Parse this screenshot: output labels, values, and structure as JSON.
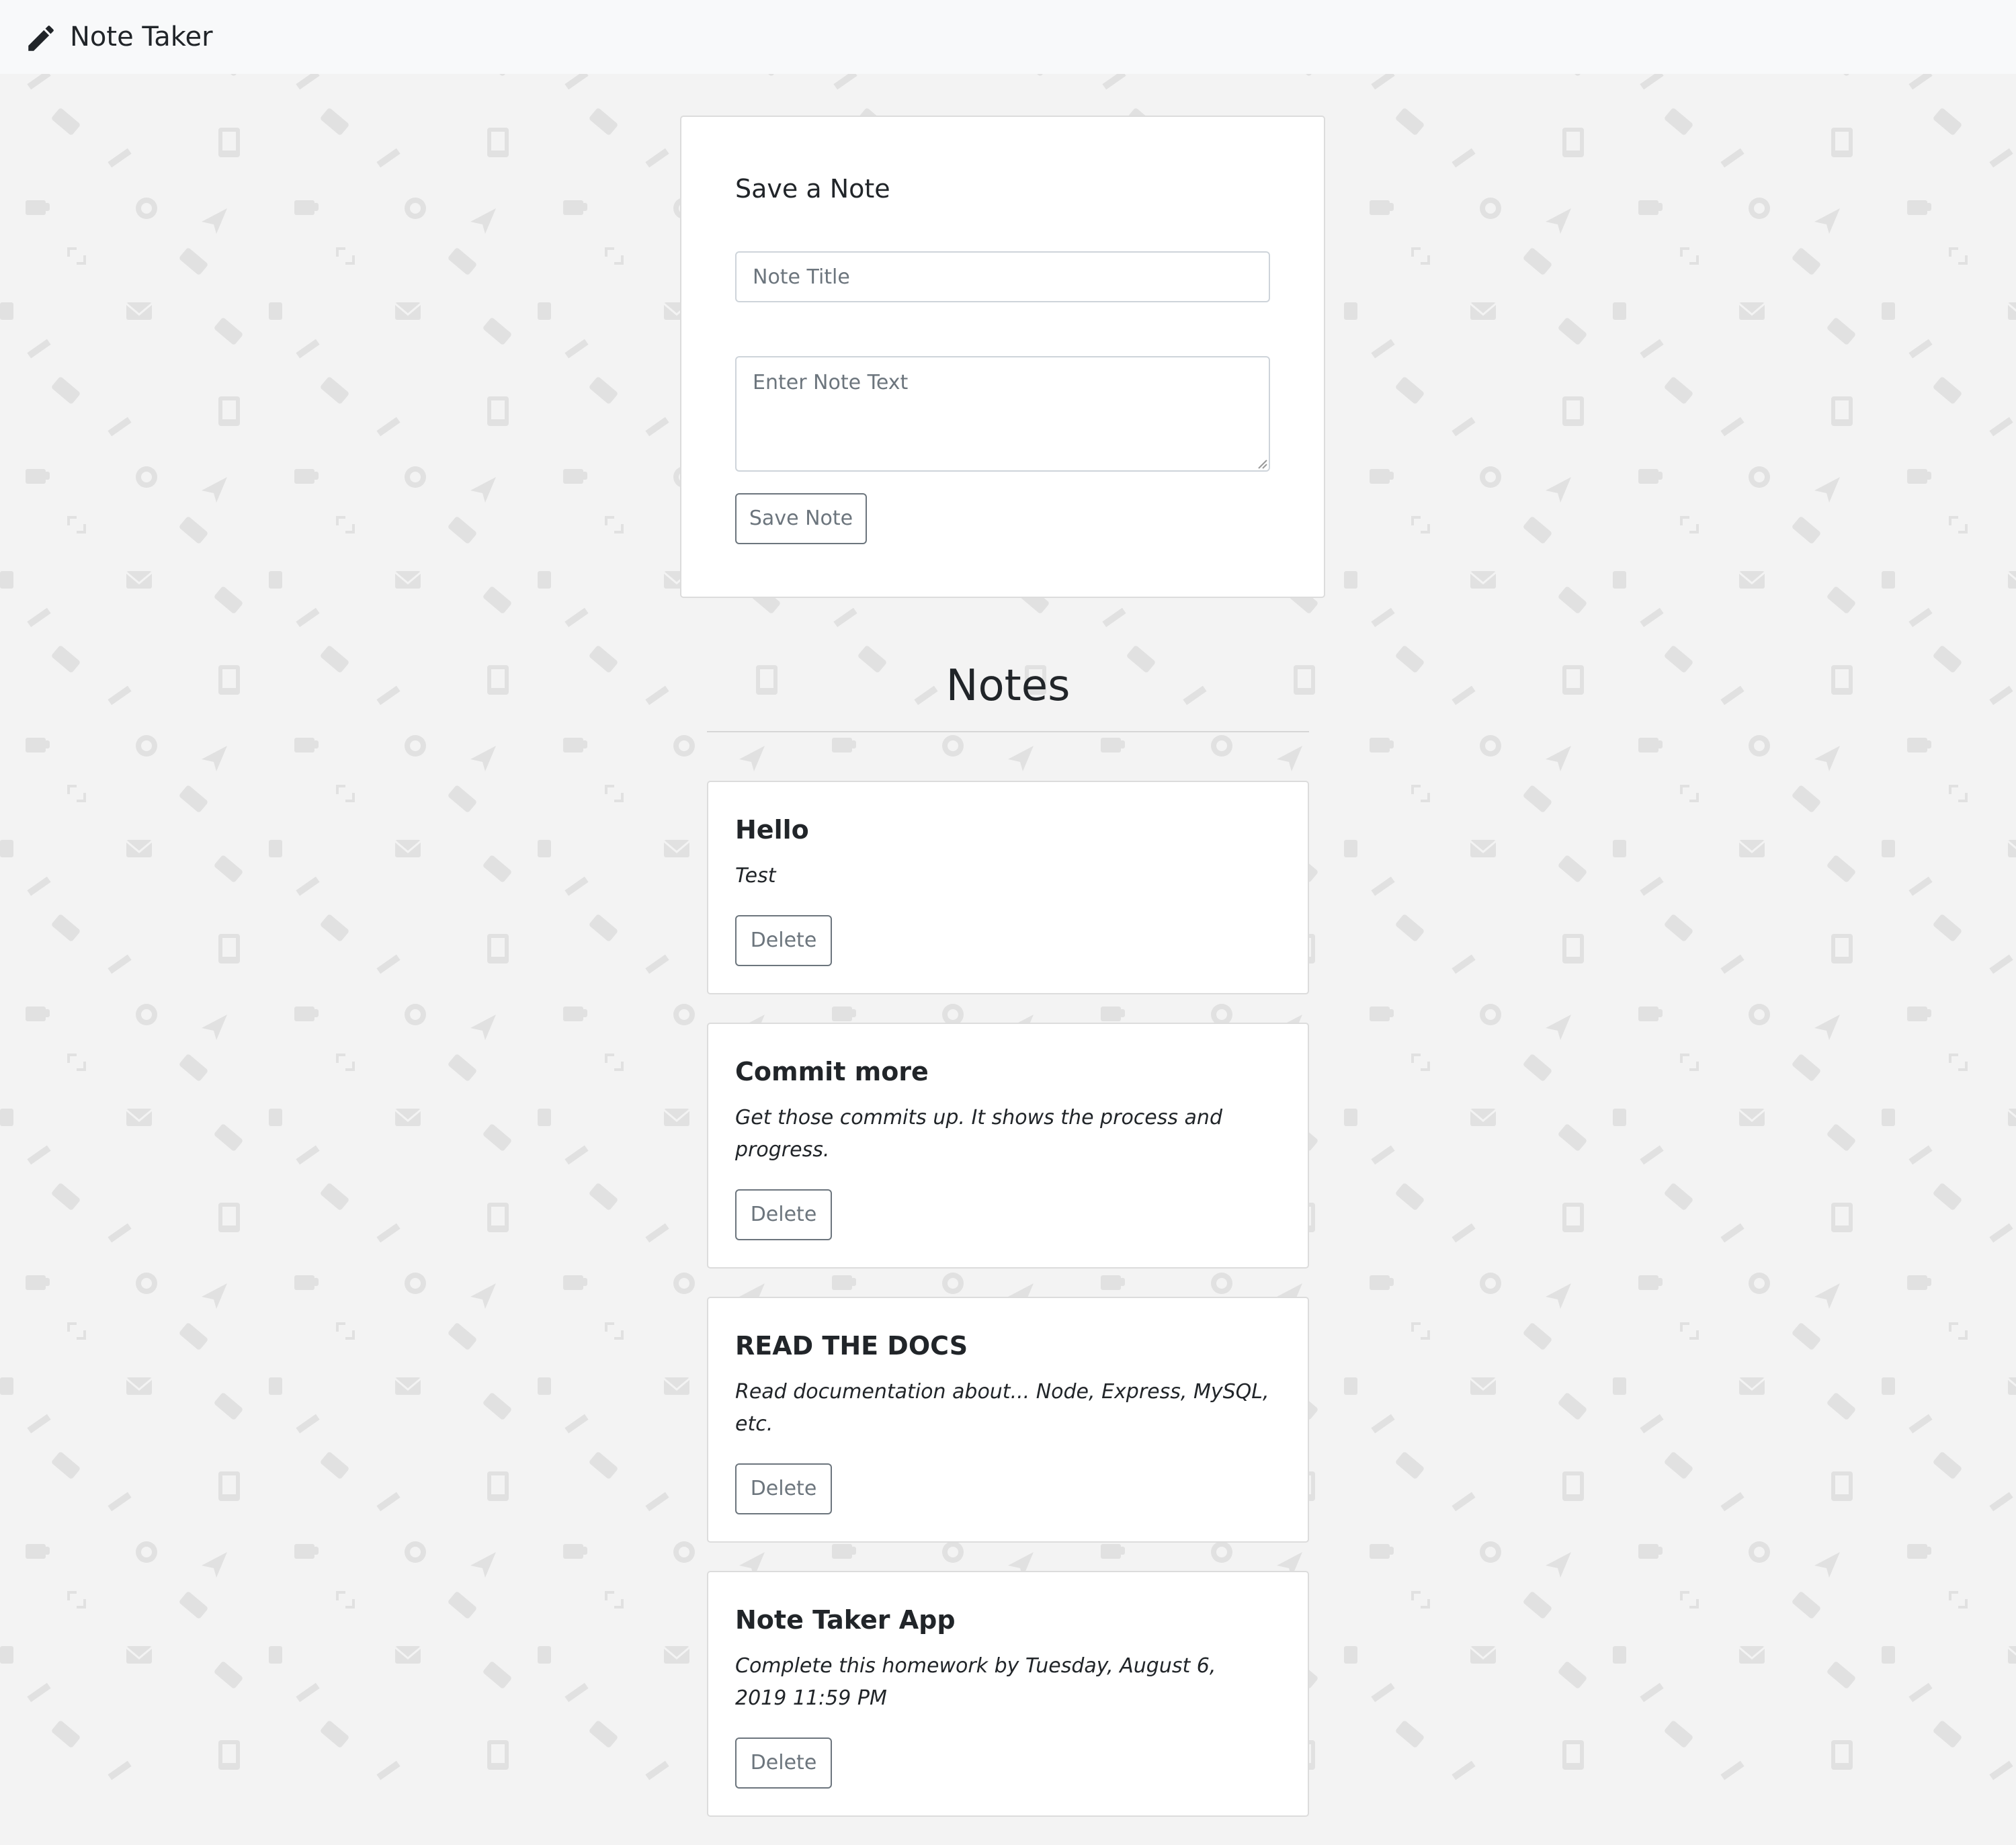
{
  "navbar": {
    "brand_label": "Note Taker",
    "brand_icon": "pencil-icon"
  },
  "form": {
    "title": "Save a Note",
    "title_placeholder": "Note Title",
    "text_placeholder": "Enter Note Text",
    "save_label": "Save Note"
  },
  "notes": {
    "heading": "Notes",
    "items": [
      {
        "title": "Hello",
        "text": "Test",
        "delete_label": "Delete"
      },
      {
        "title": "Commit more",
        "text": "Get those commits up. It shows the process and progress.",
        "delete_label": "Delete"
      },
      {
        "title": "READ THE DOCS",
        "text": "Read documentation about... Node, Express, MySQL, etc.",
        "delete_label": "Delete"
      },
      {
        "title": "Note Taker App",
        "text": "Complete this homework by Tuesday, August 6, 2019 11:59 PM",
        "delete_label": "Delete"
      }
    ]
  },
  "colors": {
    "background": "#f3f3f3",
    "navbar": "#f8f9fa",
    "card": "#ffffff",
    "button_outline": "#6c757d",
    "pattern_icon": "#e1e1e1"
  }
}
